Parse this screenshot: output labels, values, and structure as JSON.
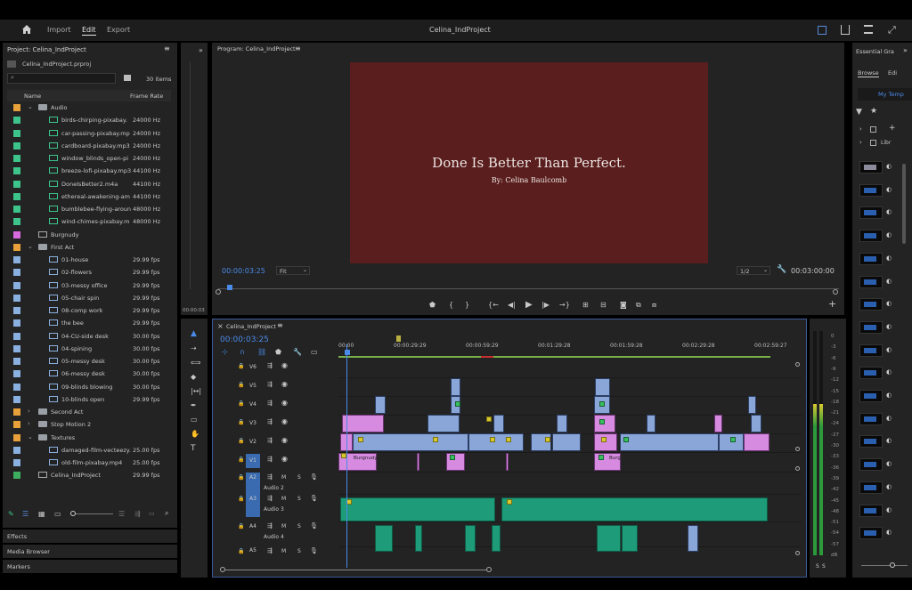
{
  "topbar": {
    "tabs": [
      "Import",
      "Edit",
      "Export"
    ],
    "active_tab": "Edit",
    "project_title": "Celina_IndProject"
  },
  "project_panel": {
    "title": "Project: Celina_IndProject",
    "file": "Celina_IndProject.prproj",
    "item_count": "30 items",
    "col_name": "Name",
    "col_rate": "Frame Rate",
    "rows": [
      {
        "name": "Audio",
        "rate": "",
        "color": "#e8a13a",
        "kind": "folder",
        "indent": 0,
        "chev": "⌄"
      },
      {
        "name": "birds-chirping-pixabay.",
        "rate": "24000 Hz",
        "color": "#3cc48a",
        "kind": "audio",
        "indent": 1
      },
      {
        "name": "car-passing-pixabay.mp",
        "rate": "24000 Hz",
        "color": "#3cc48a",
        "kind": "audio",
        "indent": 1
      },
      {
        "name": "cardboard-pixabay.mp3",
        "rate": "24000 Hz",
        "color": "#3cc48a",
        "kind": "audio",
        "indent": 1
      },
      {
        "name": "window_blinds_open-pi",
        "rate": "24000 Hz",
        "color": "#3cc48a",
        "kind": "audio",
        "indent": 1
      },
      {
        "name": "breeze-lofi-pixabay.mp3",
        "rate": "44100 Hz",
        "color": "#3cc48a",
        "kind": "audio",
        "indent": 1
      },
      {
        "name": "DoneIsBetter2.m4a",
        "rate": "44100 Hz",
        "color": "#3cc48a",
        "kind": "audio",
        "indent": 1
      },
      {
        "name": "ethereal-awakening-am",
        "rate": "44100 Hz",
        "color": "#3cc48a",
        "kind": "audio",
        "indent": 1
      },
      {
        "name": "bumblebee-flying-aroun",
        "rate": "48000 Hz",
        "color": "#3cc48a",
        "kind": "audio",
        "indent": 1
      },
      {
        "name": "wind-chimes-pixabay.m",
        "rate": "48000 Hz",
        "color": "#3cc48a",
        "kind": "audio",
        "indent": 1
      },
      {
        "name": "Burgnudy",
        "rate": "",
        "color": "#d66be0",
        "kind": "seq",
        "indent": 0
      },
      {
        "name": "First Act",
        "rate": "",
        "color": "#e8a13a",
        "kind": "folder",
        "indent": 0,
        "chev": "⌄"
      },
      {
        "name": "01-house",
        "rate": "29.99 fps",
        "color": "#8ab0e0",
        "kind": "video",
        "indent": 1
      },
      {
        "name": "02-flowers",
        "rate": "29.99 fps",
        "color": "#8ab0e0",
        "kind": "video",
        "indent": 1
      },
      {
        "name": "03-messy office",
        "rate": "29.99 fps",
        "color": "#8ab0e0",
        "kind": "video",
        "indent": 1
      },
      {
        "name": "05-chair spin",
        "rate": "29.99 fps",
        "color": "#8ab0e0",
        "kind": "video",
        "indent": 1
      },
      {
        "name": "08-comp work",
        "rate": "29.99 fps",
        "color": "#8ab0e0",
        "kind": "video",
        "indent": 1
      },
      {
        "name": "the bee",
        "rate": "29.99 fps",
        "color": "#8ab0e0",
        "kind": "video",
        "indent": 1
      },
      {
        "name": "04-CU-side desk",
        "rate": "30.00 fps",
        "color": "#8ab0e0",
        "kind": "video",
        "indent": 1
      },
      {
        "name": "04-spining",
        "rate": "30.00 fps",
        "color": "#8ab0e0",
        "kind": "video",
        "indent": 1
      },
      {
        "name": "05-messy desk",
        "rate": "30.00 fps",
        "color": "#8ab0e0",
        "kind": "video",
        "indent": 1
      },
      {
        "name": "06-messy desk",
        "rate": "30.00 fps",
        "color": "#8ab0e0",
        "kind": "video",
        "indent": 1
      },
      {
        "name": "09-blinds blowing",
        "rate": "30.00 fps",
        "color": "#8ab0e0",
        "kind": "video",
        "indent": 1
      },
      {
        "name": "10-blinds open",
        "rate": "29.99 fps",
        "color": "#8ab0e0",
        "kind": "video",
        "indent": 1
      },
      {
        "name": "Second Act",
        "rate": "",
        "color": "#e8a13a",
        "kind": "folder",
        "indent": 0,
        "chev": "›"
      },
      {
        "name": "Stop Motion 2",
        "rate": "",
        "color": "#e8a13a",
        "kind": "folder",
        "indent": 0,
        "chev": "›"
      },
      {
        "name": "Textures",
        "rate": "",
        "color": "#e8a13a",
        "kind": "folder",
        "indent": 0,
        "chev": "⌄"
      },
      {
        "name": "damaged-film-vecteezy.",
        "rate": "25.00 fps",
        "color": "#8ab0e0",
        "kind": "video",
        "indent": 1
      },
      {
        "name": "old-film-pixabay.mp4",
        "rate": "25.00 fps",
        "color": "#8ab0e0",
        "kind": "video",
        "indent": 1
      },
      {
        "name": "Celina_IndProject",
        "rate": "29.99 fps",
        "color": "#3cb060",
        "kind": "seq",
        "indent": 0
      }
    ],
    "bottom_panels": [
      "Effects",
      "Media Browser",
      "Markers"
    ]
  },
  "program_monitor": {
    "title": "Program: Celina_IndProject",
    "frame_title": "Done Is Better Than Perfect.",
    "frame_subtitle": "By: Celina Baulcomb",
    "frame_color": "#5a1e1e",
    "timecode": "00:00:03:25",
    "fit": "Fit",
    "resolution": "1/2",
    "duration": "00:03:00:00"
  },
  "source_timecode": "00:00:03",
  "timeline": {
    "title": "Celina_IndProject",
    "timecode": "00:00:03:25",
    "ruler": [
      "00:00",
      "00:00:29:29",
      "00:00:59:29",
      "00:01:29:28",
      "00:01:59:28",
      "00:02:29:28",
      "00:02:59:27"
    ],
    "video_tracks": [
      "V6",
      "V5",
      "V4",
      "V3",
      "V2",
      "V1"
    ],
    "audio_tracks": [
      {
        "id": "A2",
        "name": "Audio 2"
      },
      {
        "id": "A3",
        "name": "Audio 3"
      },
      {
        "id": "A4",
        "name": "Audio 4"
      },
      {
        "id": "A5",
        "name": ""
      }
    ],
    "clip_labels": {
      "burg1": "Burgnudy",
      "burg2": "Burg"
    },
    "track_letters": {
      "mute": "M",
      "solo": "S"
    }
  },
  "meters": {
    "labels": [
      "0",
      "-3",
      "-6",
      "-9",
      "-12",
      "-15",
      "-18",
      "-21",
      "-24",
      "-27",
      "-30",
      "-33",
      "-36",
      "-39",
      "-42",
      "-45",
      "-48",
      "-51",
      "-54",
      "-57",
      "dB"
    ],
    "solo_labels": [
      "S",
      "S"
    ]
  },
  "essential_graphics": {
    "title": "Essential Gra",
    "tab_browse": "Browse",
    "tab_edit": "Edi",
    "dropdown": "My Temp",
    "lib_label": "Libr"
  }
}
